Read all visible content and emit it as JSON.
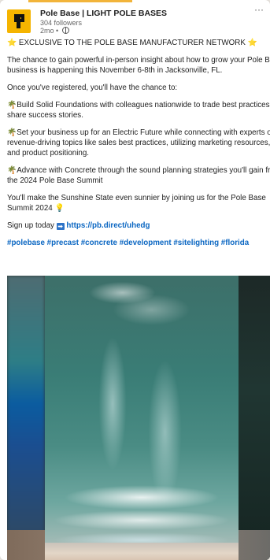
{
  "post": {
    "company_name": "Pole Base | LIGHT POLE BASES",
    "followers": "304 followers",
    "age": "2mo •",
    "more_label": "···",
    "line1": "⭐ EXCLUSIVE TO THE POLE BASE MANUFACTURER NETWORK ⭐",
    "line2a": "The chance to gain powerful in-person insight about how to grow your Pole Base",
    "line2b": "business is happening this November 6-8th in Jacksonville, FL.",
    "line3": "Once you've registered, you'll have the chance to:",
    "line4a": "🌴Build Solid Foundations with colleagues nationwide to trade best practices and",
    "line4b": "share success stories.",
    "line5a": "🌴Set your business up for an Electric Future while connecting with experts on",
    "line5b": "revenue-driving topics like sales best practices, utilizing marketing resources,",
    "line5c": "and product positioning.",
    "line6a": "🌴Advance with Concrete through the sound planning strategies you'll gain from",
    "line6b": "the 2024 Pole Base Summit",
    "line7a": "You'll make the Sunshine State even sunnier by joining us for the Pole Base",
    "line7b": "Summit 2024 💡",
    "signup_prefix": "Sign up today ",
    "arrow": "➡",
    "signup_link": "https://pb.direct/uhedg",
    "hashtags": [
      "#polebase",
      "#precast",
      "#concrete",
      "#development",
      "#sitelighting",
      "#florida"
    ]
  },
  "icons": {
    "logo": "pole-base-logo",
    "globe": "globe-icon",
    "more": "more-options-icon"
  },
  "colors": {
    "logo_bg": "#f5b400",
    "link": "#0a66c2"
  }
}
